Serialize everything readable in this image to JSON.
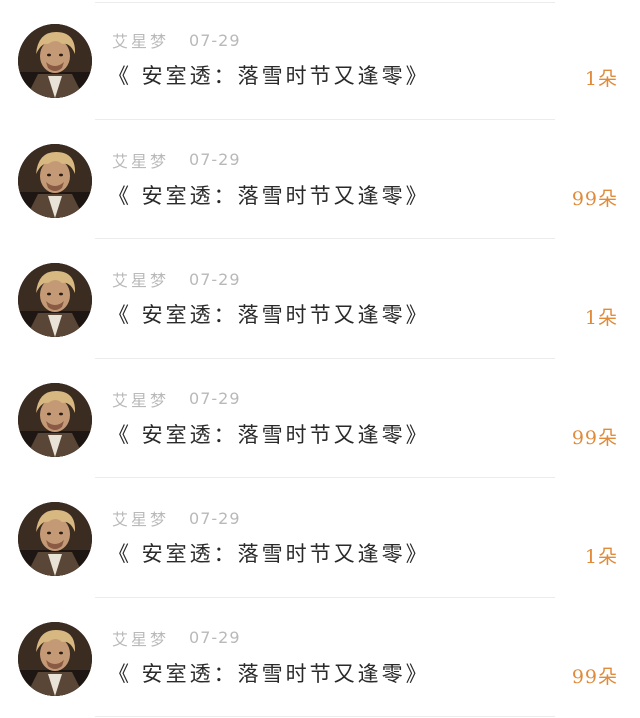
{
  "gifts": [
    {
      "user": "艾星梦",
      "date": "07-29",
      "title": "《 安室透：落雪时节又逢零》",
      "amount": "1朵"
    },
    {
      "user": "艾星梦",
      "date": "07-29",
      "title": "《 安室透：落雪时节又逢零》",
      "amount": "99朵"
    },
    {
      "user": "艾星梦",
      "date": "07-29",
      "title": "《 安室透：落雪时节又逢零》",
      "amount": "1朵"
    },
    {
      "user": "艾星梦",
      "date": "07-29",
      "title": "《 安室透：落雪时节又逢零》",
      "amount": "99朵"
    },
    {
      "user": "艾星梦",
      "date": "07-29",
      "title": "《 安室透：落雪时节又逢零》",
      "amount": "1朵"
    },
    {
      "user": "艾星梦",
      "date": "07-29",
      "title": "《 安室透：落雪时节又逢零》",
      "amount": "99朵"
    }
  ],
  "colors": {
    "amount": "#e08a3a",
    "meta": "#b9b9b9",
    "title": "#2a2a2a"
  },
  "icons": {
    "avatar": "user-avatar-icon"
  }
}
